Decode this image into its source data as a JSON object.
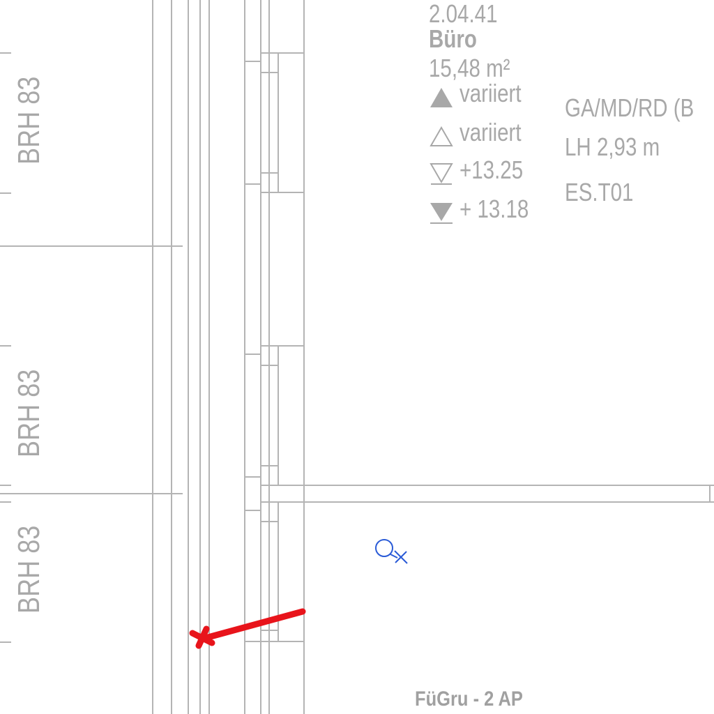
{
  "room": {
    "number": "2.04.41",
    "name": "Büro",
    "area": "15,48 m²"
  },
  "levels": [
    {
      "icon": "filled-up-triangle-icon",
      "text": "variiert"
    },
    {
      "icon": "outline-up-triangle-icon",
      "text": "variiert"
    },
    {
      "icon": "outline-down-triangle-icon",
      "text": "+13.25"
    },
    {
      "icon": "filled-down-triangle-icon",
      "text": "+ 13.18"
    }
  ],
  "ceiling": {
    "type": "GA/MD/RD (B",
    "height": "LH 2,93 m",
    "code": "ES.T01"
  },
  "parapets": [
    "BRH 83",
    "BRH 83",
    "BRH 83"
  ],
  "footer_label": "FüGru -  2 AP",
  "colors": {
    "linework": "#b0b0b0",
    "text": "#a8a8a8",
    "marker_red": "#e8141b",
    "symbol_blue": "#2a5bd7"
  }
}
